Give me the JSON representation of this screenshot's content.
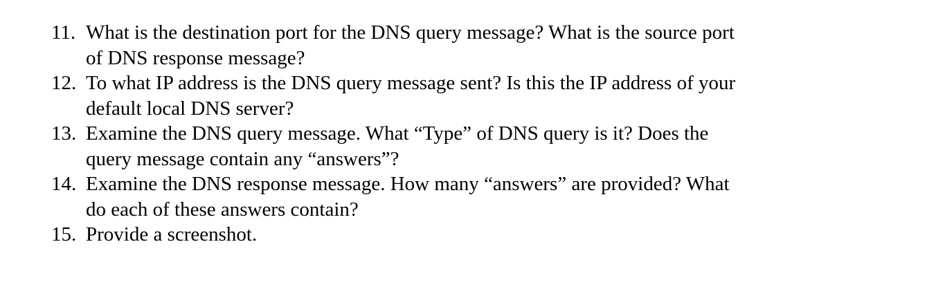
{
  "questions": [
    {
      "number": "11.",
      "lines": [
        "What is the destination port for the DNS query message? What is the source port",
        "of DNS response message?"
      ]
    },
    {
      "number": "12.",
      "lines": [
        "To what IP address is the DNS query message sent? Is this the IP address of your",
        "default local DNS server?"
      ]
    },
    {
      "number": "13.",
      "lines": [
        "Examine the DNS query message. What “Type” of DNS query is it? Does the",
        "query message contain any “answers”?"
      ]
    },
    {
      "number": "14.",
      "lines": [
        "Examine the DNS response message. How many “answers” are provided? What",
        "do each of these answers contain?"
      ]
    },
    {
      "number": "15.",
      "lines": [
        "Provide a screenshot."
      ]
    }
  ]
}
